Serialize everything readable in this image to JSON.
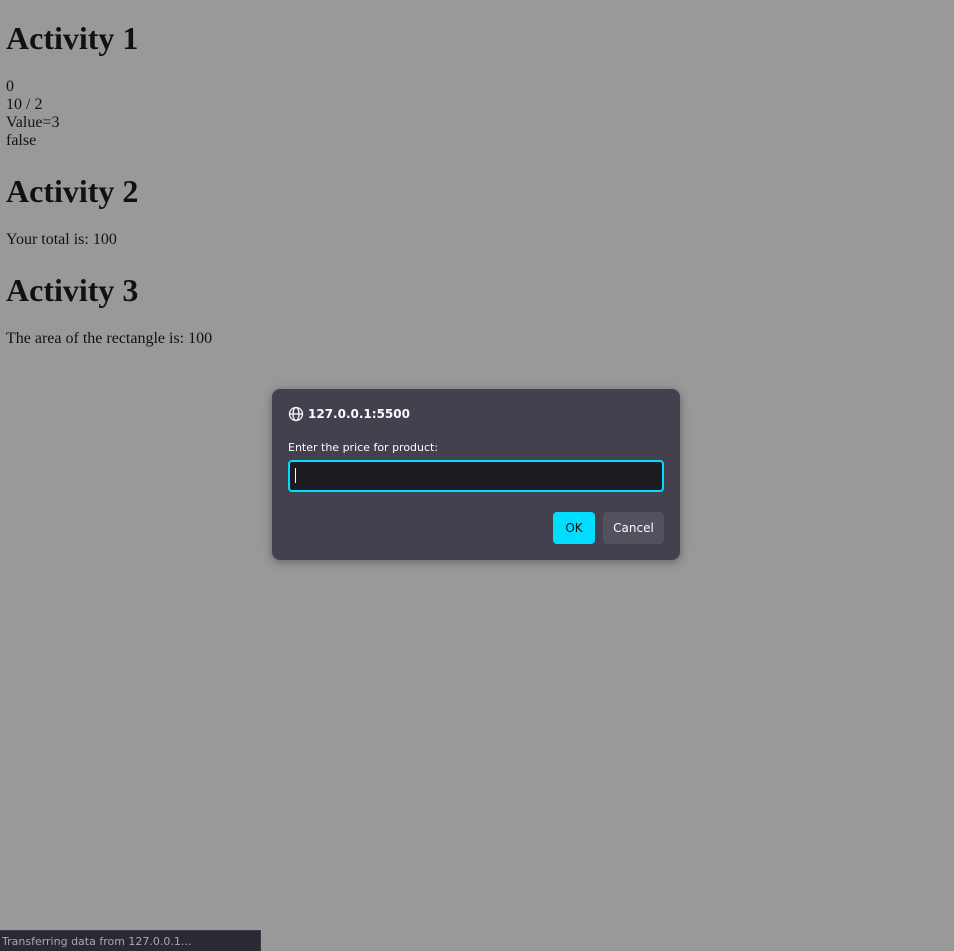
{
  "activity1": {
    "heading": "Activity 1",
    "lines": [
      "0",
      "10 / 2",
      "Value=3",
      "false"
    ]
  },
  "activity2": {
    "heading": "Activity 2",
    "text": "Your total is: 100"
  },
  "activity3": {
    "heading": "Activity 3",
    "text": "The area of the rectangle is: 100"
  },
  "dialog": {
    "origin": "127.0.0.1:5500",
    "origin_icon": "globe-icon",
    "message": "Enter the price for product:",
    "input_value": "",
    "ok_label": "OK",
    "cancel_label": "Cancel",
    "accent_color": "#00ddff"
  },
  "status_bar": {
    "text": "Transferring data from 127.0.0.1..."
  },
  "colors": {
    "page_overlay": "#999999",
    "dialog_bg": "#42414d",
    "input_bg": "#1c1b22"
  }
}
